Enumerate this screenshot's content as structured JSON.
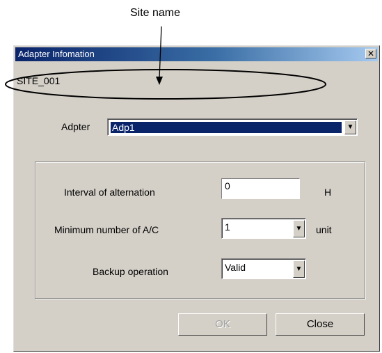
{
  "callout": {
    "label": "Site name"
  },
  "dialog": {
    "title": "Adapter Infomation",
    "close_glyph": "✕",
    "site": "SITE_001",
    "adapter": {
      "label": "Adpter",
      "value": "Adp1"
    },
    "interval": {
      "label": "Interval of alternation",
      "value": "0",
      "unit": "H"
    },
    "min_ac": {
      "label": "Minimum number of A/C",
      "value": "1",
      "unit": "unit"
    },
    "backup": {
      "label": "Backup operation",
      "value": "Valid"
    },
    "buttons": {
      "ok": "OK",
      "close": "Close"
    }
  },
  "icons": {
    "dropdown": "chevron-down-icon",
    "close": "close-icon"
  }
}
